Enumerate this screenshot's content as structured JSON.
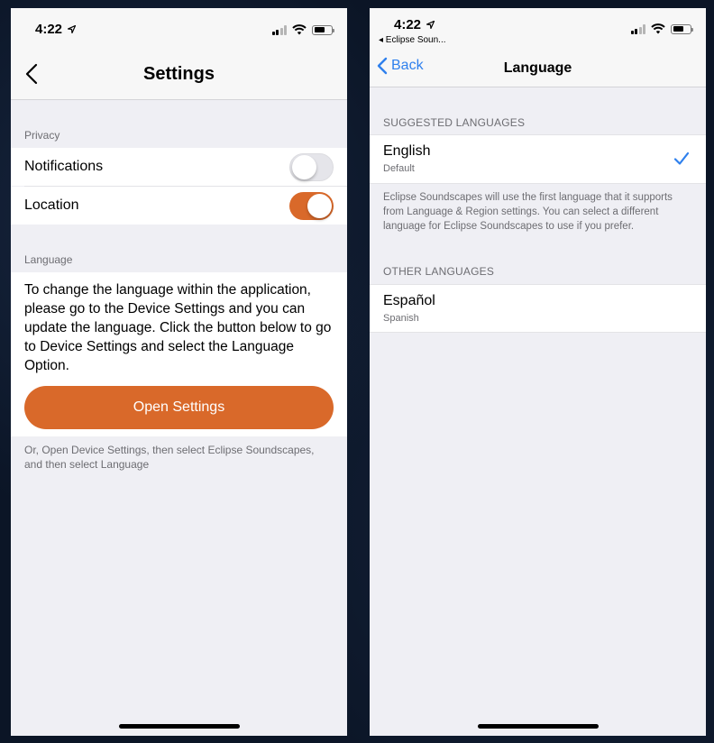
{
  "colors": {
    "accent_orange": "#d9692a",
    "ios_blue": "#2f80ed"
  },
  "left_screen": {
    "status": {
      "time": "4:22"
    },
    "nav": {
      "title": "Settings",
      "back_icon": "chevron-left-icon"
    },
    "privacy_section": {
      "label": "Privacy",
      "rows": [
        {
          "label": "Notifications",
          "toggle_on": false
        },
        {
          "label": "Location",
          "toggle_on": true
        }
      ]
    },
    "language_section": {
      "label": "Language",
      "description": "To change the language within the application, please go to the Device Settings and you can update the language. Click the button below to go to Device Settings and select the Language Option.",
      "button_label": "Open Settings",
      "footnote": "Or, Open Device Settings, then select Eclipse Soundscapes, and then select Language"
    }
  },
  "right_screen": {
    "status": {
      "time": "4:22",
      "back_app": "◂ Eclipse Soun..."
    },
    "nav": {
      "back_label": "Back",
      "title": "Language"
    },
    "suggested": {
      "label": "SUGGESTED LANGUAGES",
      "items": [
        {
          "name": "English",
          "subtitle": "Default",
          "selected": true
        }
      ]
    },
    "info_text": "Eclipse Soundscapes will use the first language that it supports from Language & Region settings. You can select a different language for Eclipse Soundscapes to use if you prefer.",
    "other": {
      "label": "OTHER LANGUAGES",
      "items": [
        {
          "name": "Español",
          "subtitle": "Spanish",
          "selected": false
        }
      ]
    }
  }
}
